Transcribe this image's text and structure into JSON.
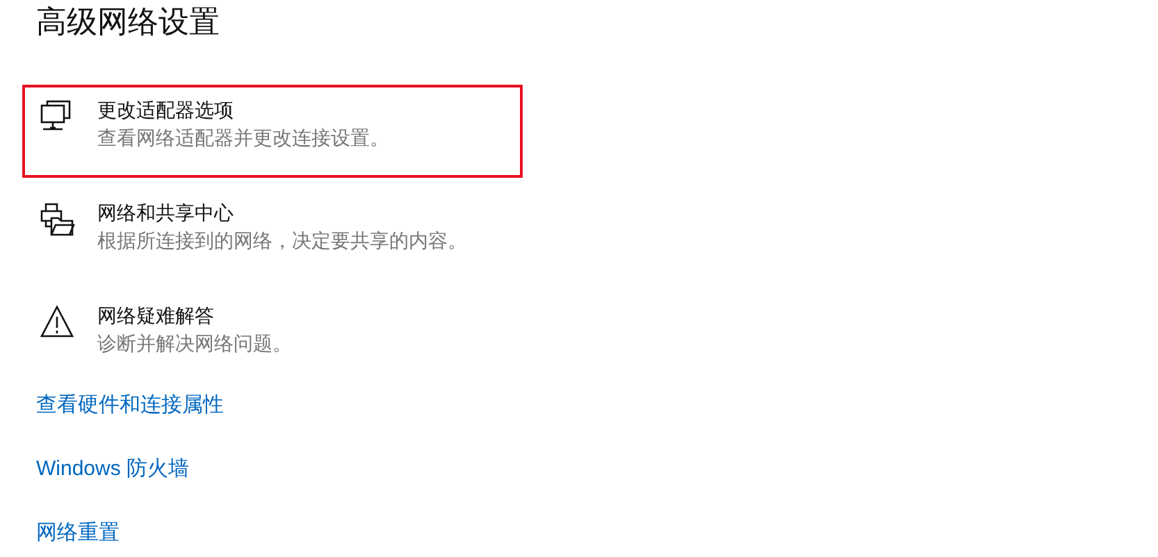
{
  "title": "高级网络设置",
  "items": [
    {
      "kind": "adapter",
      "title": "更改适配器选项",
      "description": "查看网络适配器并更改连接设置。",
      "highlighted": true
    },
    {
      "kind": "sharing",
      "title": "网络和共享中心",
      "description": "根据所连接到的网络，决定要共享的内容。",
      "highlighted": false
    },
    {
      "kind": "warning",
      "title": "网络疑难解答",
      "description": "诊断并解决网络问题。",
      "highlighted": false
    }
  ],
  "links": [
    "查看硬件和连接属性",
    "Windows 防火墙",
    "网络重置"
  ]
}
